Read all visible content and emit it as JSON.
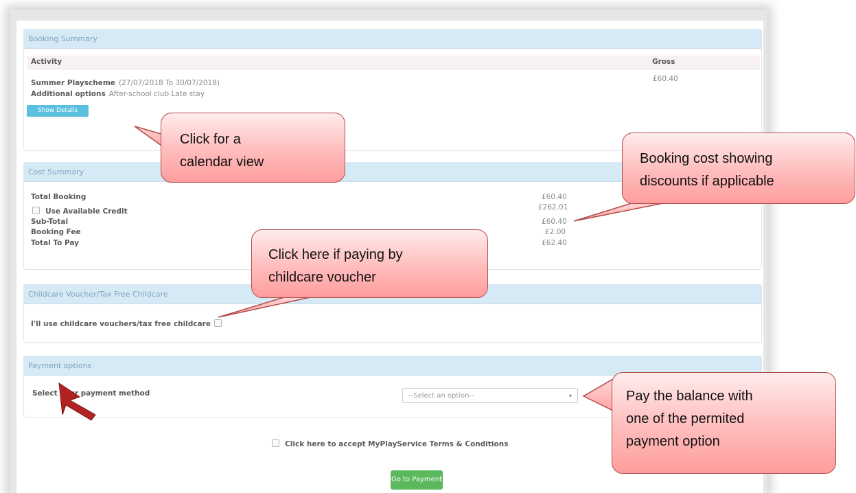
{
  "booking_summary": {
    "header": "Booking Summary",
    "col_activity": "Activity",
    "col_gross": "Gross",
    "activity_name": "Summer Playscheme",
    "activity_dates": "(27/07/2018 To 30/07/2018)",
    "additional_label": "Additional options",
    "additional_value": "After-school club Late stay",
    "gross_value": "£60.40",
    "show_details_label": "Show Details"
  },
  "cost_summary": {
    "header": "Cost Summary",
    "total_booking_label": "Total Booking",
    "total_booking_value": "£60.40",
    "use_credit_label": "Use Available Credit",
    "use_credit_value": "£262.01",
    "subtotal_label": "Sub-Total",
    "subtotal_value": "£60.40",
    "booking_fee_label": "Booking Fee",
    "booking_fee_value": "£2.00",
    "total_to_pay_label": "Total To Pay",
    "total_to_pay_value": "£62.40"
  },
  "voucher": {
    "header": "Childcare Voucher/Tax Free Childcare",
    "label": "I'll use childcare vouchers/tax free childcare"
  },
  "payment": {
    "header": "Payment options",
    "select_label": "Select your payment method",
    "select_placeholder": "--Select an option--",
    "terms_label": "Click here to accept MyPlayService Terms & Conditions",
    "go_button": "Go to Payment"
  },
  "callouts": {
    "calendar_line1": "Click for a",
    "calendar_line2": "calendar view",
    "cost_line1": "Booking cost showing",
    "cost_line2": "discounts if applicable",
    "voucher_line1": "Click here if paying by",
    "voucher_line2": "childcare voucher",
    "pay_line1": "Pay the balance with",
    "pay_line2": "one of the permited",
    "pay_line3": "payment option"
  },
  "colors": {
    "panel_header_bg": "#d6eaf6",
    "show_details_btn": "#5bc0de",
    "go_payment_btn": "#5cb85c",
    "callout_fill": "#ffbcbc",
    "arrow": "#b22222"
  }
}
